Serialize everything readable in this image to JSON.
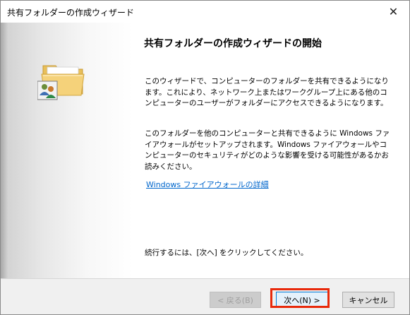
{
  "window": {
    "title": "共有フォルダーの作成ウィザード",
    "close_glyph": "✕"
  },
  "main": {
    "heading": "共有フォルダーの作成ウィザードの開始",
    "paragraph1": "このウィザードで、コンピューターのフォルダーを共有できるようになります。これにより、ネットワーク上またはワークグループ上にある他のコンピューターのユーザーがフォルダーにアクセスできるようになります。",
    "paragraph2": "このフォルダーを他のコンピューターと共有できるように Windows ファイアウォールがセットアップされます。Windows ファイアウォールやコンピューターのセキュリティがどのような影響を受ける可能性があるかお読みください。",
    "firewall_link": "Windows ファイアウォールの詳細",
    "continue_hint": "続行するには、[次へ] をクリックしてください。"
  },
  "buttons": {
    "back": "< 戻る(B)",
    "next": "次へ(N) >",
    "cancel": "キャンセル"
  },
  "icons": {
    "wizard": "shared-folder-icon"
  },
  "colors": {
    "link": "#0066cc",
    "highlight": "#e8290b",
    "folder": "#f5d27a"
  }
}
